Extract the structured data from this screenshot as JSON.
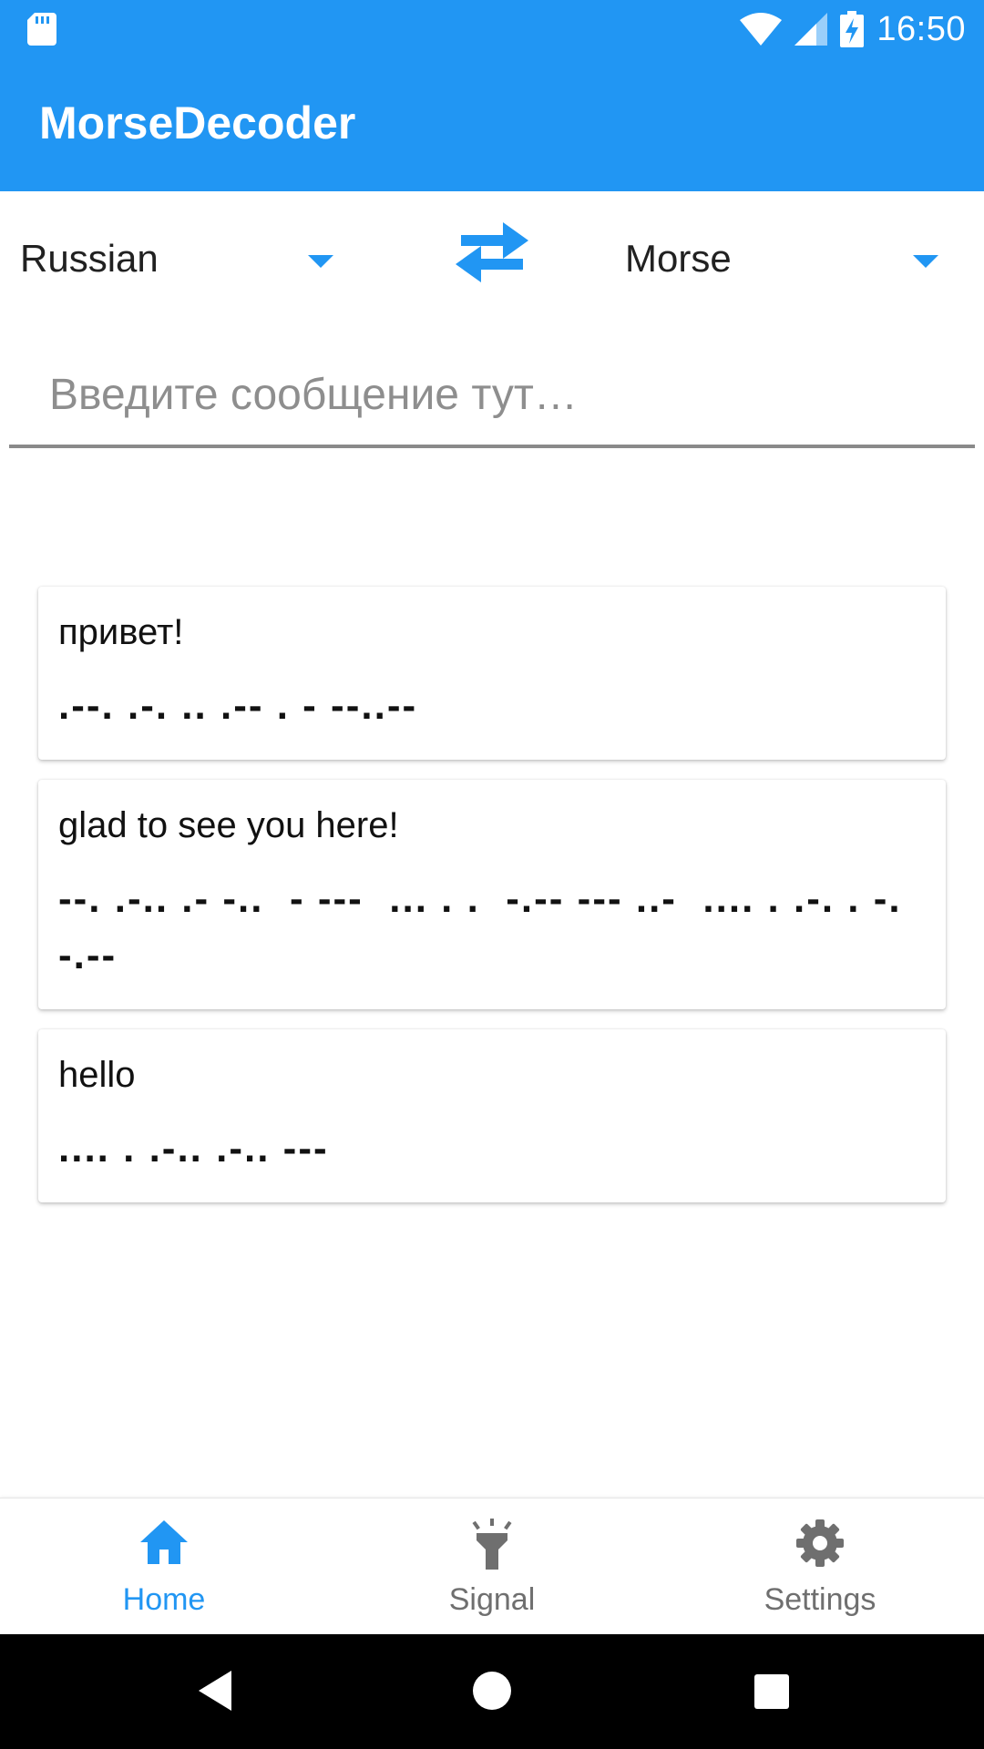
{
  "status_bar": {
    "time": "16:50",
    "icons": [
      "sd-card-icon",
      "wifi-icon",
      "cell-signal-icon",
      "battery-charging-icon"
    ]
  },
  "app_bar": {
    "title": "MorseDecoder"
  },
  "language_selector": {
    "source": "Russian",
    "target": "Morse",
    "swap_icon": "swap-arrows-icon"
  },
  "input": {
    "placeholder": "Введите сообщение тут…",
    "value": ""
  },
  "history": [
    {
      "plain": "привет!",
      "morse": ".--. .-. .. .-- . - --..--"
    },
    {
      "plain": "glad to see you here!",
      "morse": "--. .-.. .- -..  - ---  ... . .  -.-- --- ..-  .... . .-. . -.-.--"
    },
    {
      "plain": "hello",
      "morse": ".... . .-.. .-.. ---"
    }
  ],
  "bottom_nav": {
    "items": [
      {
        "label": "Home",
        "icon": "home-icon",
        "active": true
      },
      {
        "label": "Signal",
        "icon": "flashlight-icon",
        "active": false
      },
      {
        "label": "Settings",
        "icon": "gear-icon",
        "active": false
      }
    ]
  },
  "system_nav": {
    "icons": [
      "back-icon",
      "home-circle-icon",
      "recents-icon"
    ]
  },
  "colors": {
    "primary": "#2196f3",
    "text": "#212121",
    "inactive": "#6f6f6f"
  }
}
